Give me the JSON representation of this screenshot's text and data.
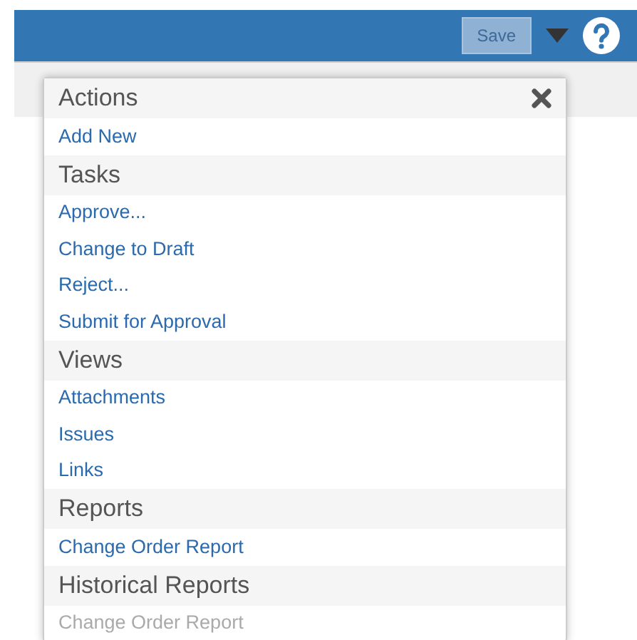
{
  "toolbar": {
    "save_button": {
      "label": "Save",
      "disabled": true
    }
  },
  "menu": {
    "sections": [
      {
        "title": "Actions",
        "items": [
          {
            "label": "Add New",
            "disabled": false
          }
        ]
      },
      {
        "title": "Tasks",
        "items": [
          {
            "label": "Approve...",
            "disabled": false
          },
          {
            "label": "Change to Draft",
            "disabled": false
          },
          {
            "label": "Reject...",
            "disabled": false
          },
          {
            "label": "Submit for Approval",
            "disabled": false
          }
        ]
      },
      {
        "title": "Views",
        "items": [
          {
            "label": "Attachments",
            "disabled": false
          },
          {
            "label": "Issues",
            "disabled": false
          },
          {
            "label": "Links",
            "disabled": false
          }
        ]
      },
      {
        "title": "Reports",
        "items": [
          {
            "label": "Change Order Report",
            "disabled": false
          }
        ]
      },
      {
        "title": "Historical Reports",
        "items": [
          {
            "label": "Change Order Report",
            "disabled": true
          }
        ]
      }
    ]
  }
}
